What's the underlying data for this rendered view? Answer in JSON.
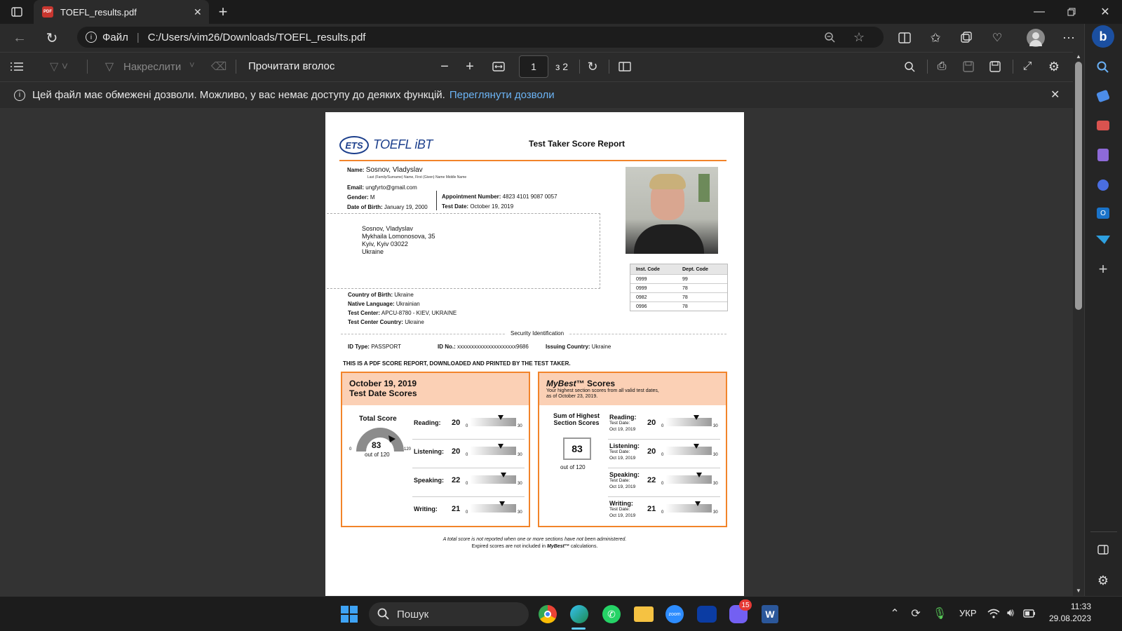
{
  "browser": {
    "tab_title": "TOEFL_results.pdf",
    "url_label": "Файл",
    "url": "C:/Users/vim26/Downloads/TOEFL_results.pdf"
  },
  "pdf_toolbar": {
    "draw_label": "Накреслити",
    "read_aloud_label": "Прочитати вголос",
    "page_current": "1",
    "page_total": "з 2"
  },
  "infobar": {
    "message": "Цей файл має обмежені дозволи. Можливо, у вас немає доступу до деяких функцій.",
    "link": "Переглянути дозволи"
  },
  "report": {
    "logo_ets": "ETS",
    "logo_toefl": "TOEFL iBT",
    "title": "Test Taker Score Report",
    "name_label": "Name:",
    "name_value": "Sosnov, Vladyslav",
    "name_hint": "Last (Family/Surname) Name, First (Given) Name Middle Name",
    "email_label": "Email:",
    "email_value": "ungfyrto@gmail.com",
    "gender_label": "Gender:",
    "gender_value": "M",
    "dob_label": "Date of Birth:",
    "dob_value": "January 19, 2000",
    "appt_label": "Appointment Number:",
    "appt_value": "4823 4101 9087 0057",
    "testdate_label": "Test Date:",
    "testdate_value": "October 19, 2019",
    "address": [
      "Sosnov, Vladyslav",
      "Mykhaila Lomonosova, 35",
      "Kyiv, Kyiv 03022",
      "Ukraine"
    ],
    "inst_headers": [
      "Inst. Code",
      "Dept. Code"
    ],
    "inst_rows": [
      [
        "0999",
        "99"
      ],
      [
        "0999",
        "78"
      ],
      [
        "0982",
        "78"
      ],
      [
        "0996",
        "78"
      ]
    ],
    "cob_label": "Country of Birth:",
    "cob_value": "Ukraine",
    "lang_label": "Native Language:",
    "lang_value": "Ukrainian",
    "center_label": "Test Center:",
    "center_value": "APCU-8780 - KIEV, UKRAINE",
    "center_country_label": "Test Center Country:",
    "center_country_value": "Ukraine",
    "security_label": "Security Identification",
    "idtype_label": "ID Type:",
    "idtype_value": "PASSPORT",
    "idno_label": "ID No.:",
    "idno_value": "xxxxxxxxxxxxxxxxxxxxx9686",
    "issuing_label": "Issuing Country:",
    "issuing_value": "Ukraine",
    "pdf_notice": "THIS IS A PDF SCORE REPORT, DOWNLOADED AND PRINTED BY THE TEST TAKER.",
    "left_box": {
      "date": "October 19, 2019",
      "subtitle": "Test Date Scores",
      "total_label": "Total Score",
      "total": "83",
      "out_of": "out of 120",
      "gauge_min": "0",
      "gauge_max": "120",
      "sections": [
        {
          "name": "Reading:",
          "score": "20",
          "fraction": 0.667
        },
        {
          "name": "Listening:",
          "score": "20",
          "fraction": 0.667
        },
        {
          "name": "Speaking:",
          "score": "22",
          "fraction": 0.733
        },
        {
          "name": "Writing:",
          "score": "21",
          "fraction": 0.7
        }
      ],
      "bar_min": "0",
      "bar_max": "30"
    },
    "right_box": {
      "title_italic": "MyBest",
      "title_rest": "™ Scores",
      "desc1": "Your highest section scores from all valid test dates,",
      "desc2": "as of October 23, 2019.",
      "sum_label1": "Sum of Highest",
      "sum_label2": "Section Scores",
      "total": "83",
      "out_of": "out of 120",
      "sections": [
        {
          "name": "Reading:",
          "date_label": "Test Date:",
          "date": "Oct 19, 2019",
          "score": "20",
          "fraction": 0.667
        },
        {
          "name": "Listening:",
          "date_label": "Test Date:",
          "date": "Oct 19, 2019",
          "score": "20",
          "fraction": 0.667
        },
        {
          "name": "Speaking:",
          "date_label": "Test Date:",
          "date": "Oct 19, 2019",
          "score": "22",
          "fraction": 0.733
        },
        {
          "name": "Writing:",
          "date_label": "Test Date:",
          "date": "Oct 19, 2019",
          "score": "21",
          "fraction": 0.7
        }
      ]
    },
    "footnote1": "A total score is not reported when one or more sections have not been administered.",
    "footnote2a": "Expired scores are not included in ",
    "footnote2b": "MyBest™",
    "footnote2c": " calculations."
  },
  "taskbar": {
    "search_placeholder": "Пошук",
    "viber_badge": "15",
    "lang": "УКР",
    "time": "11:33",
    "date": "29.08.2023"
  }
}
